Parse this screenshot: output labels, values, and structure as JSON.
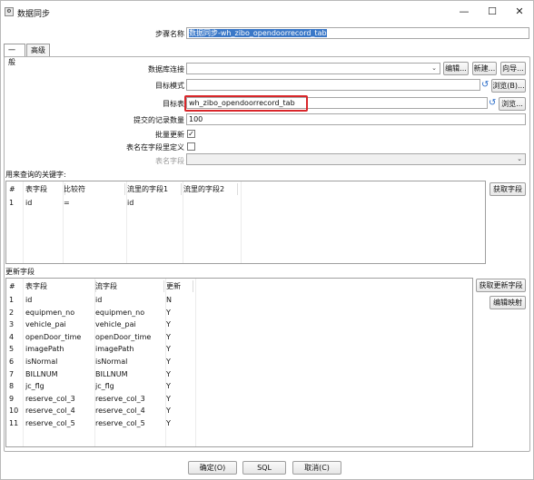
{
  "window": {
    "title": "数据同步",
    "minimize": "—",
    "maximize": "☐",
    "close": "✕"
  },
  "step_name": {
    "label": "步骤名称",
    "value": "数据同步-wh_zibo_opendoorrecord_tab"
  },
  "tabs": [
    {
      "label": "一般"
    },
    {
      "label": "高级"
    }
  ],
  "db": {
    "label": "数据库连接",
    "edit": "编辑...",
    "new": "新建...",
    "wizard": "向导..."
  },
  "target_schema": {
    "label": "目标模式",
    "browse": "浏览(B)..."
  },
  "target_table": {
    "label": "目标表",
    "value": "wh_zibo_opendoorrecord_tab",
    "browse": "浏览..."
  },
  "commit_size": {
    "label": "提交的记录数量",
    "value": "100"
  },
  "batch_update": {
    "label": "批量更新",
    "checked": "✓"
  },
  "table_in_field": {
    "label": "表名在字段里定义"
  },
  "table_field": {
    "label": "表名字段"
  },
  "keys": {
    "title": "用来查询的关键字:",
    "get_fields": "获取字段",
    "headers": [
      "#",
      "表字段",
      "比较符",
      "流里的字段1",
      "流里的字段2"
    ],
    "rows": [
      [
        "1",
        "id",
        "=",
        "id",
        ""
      ]
    ]
  },
  "update": {
    "title": "更新字段",
    "get_update": "获取更新字段",
    "edit_mapping": "编辑映射",
    "headers": [
      "#",
      "表字段",
      "流字段",
      "更新"
    ],
    "rows": [
      [
        "1",
        "id",
        "id",
        "N"
      ],
      [
        "2",
        "equipmen_no",
        "equipmen_no",
        "Y"
      ],
      [
        "3",
        "vehicle_pai",
        "vehicle_pai",
        "Y"
      ],
      [
        "4",
        "openDoor_time",
        "openDoor_time",
        "Y"
      ],
      [
        "5",
        "imagePath",
        "imagePath",
        "Y"
      ],
      [
        "6",
        "isNormal",
        "isNormal",
        "Y"
      ],
      [
        "7",
        "BILLNUM",
        "BILLNUM",
        "Y"
      ],
      [
        "8",
        "jc_flg",
        "jc_flg",
        "Y"
      ],
      [
        "9",
        "reserve_col_3",
        "reserve_col_3",
        "Y"
      ],
      [
        "10",
        "reserve_col_4",
        "reserve_col_4",
        "Y"
      ],
      [
        "11",
        "reserve_col_5",
        "reserve_col_5",
        "Y"
      ]
    ]
  },
  "footer": {
    "ok": "确定(O)",
    "sql": "SQL",
    "cancel": "取消(C)"
  },
  "colors": {
    "accent": "#3a78c8",
    "highlight": "#d9262a"
  }
}
